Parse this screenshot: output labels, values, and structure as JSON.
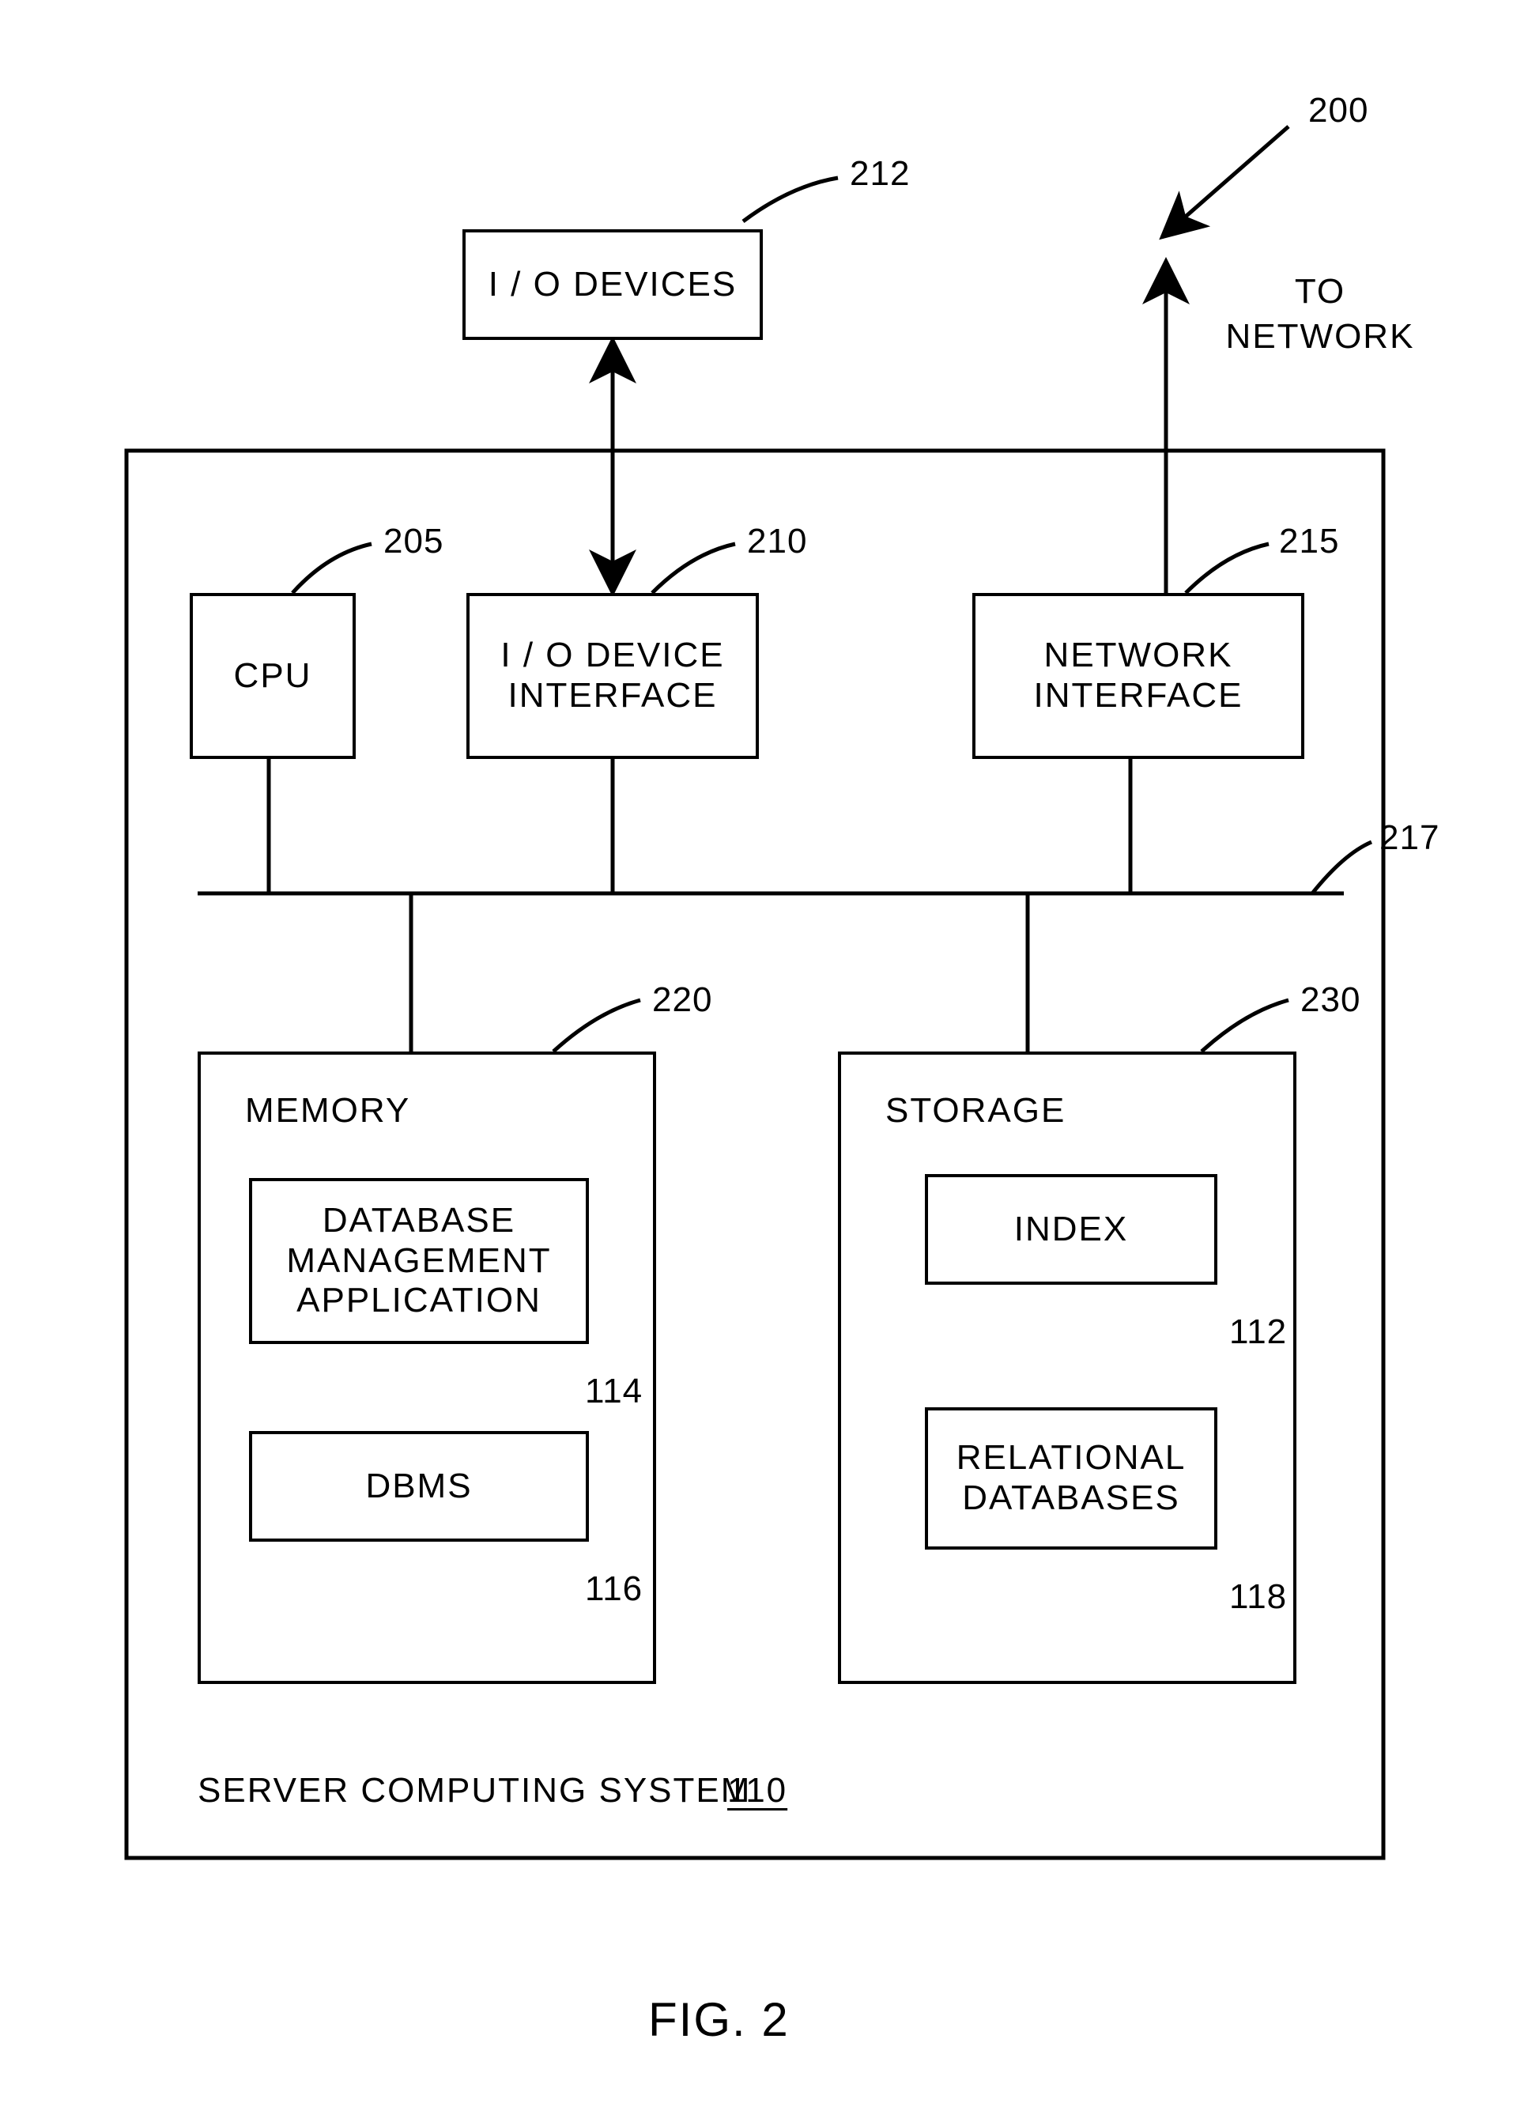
{
  "fig": {
    "ref200": "200",
    "ref212": "212",
    "ref205": "205",
    "ref210": "210",
    "ref215": "215",
    "ref217": "217",
    "ref220": "220",
    "ref230": "230",
    "ref114": "114",
    "ref116": "116",
    "ref112": "112",
    "ref118": "118",
    "ref110": "110",
    "io_devices": "I / O DEVICES",
    "to_network": "TO\nNETWORK",
    "cpu": "CPU",
    "io_iface": "I / O DEVICE\nINTERFACE",
    "net_iface": "NETWORK\nINTERFACE",
    "memory": "MEMORY",
    "storage": "STORAGE",
    "dbma": "DATABASE\nMANAGEMENT\nAPPLICATION",
    "dbms": "DBMS",
    "index": "INDEX",
    "reldb": "RELATIONAL\nDATABASES",
    "server": "SERVER COMPUTING SYSTEM",
    "caption": "FIG. 2"
  }
}
